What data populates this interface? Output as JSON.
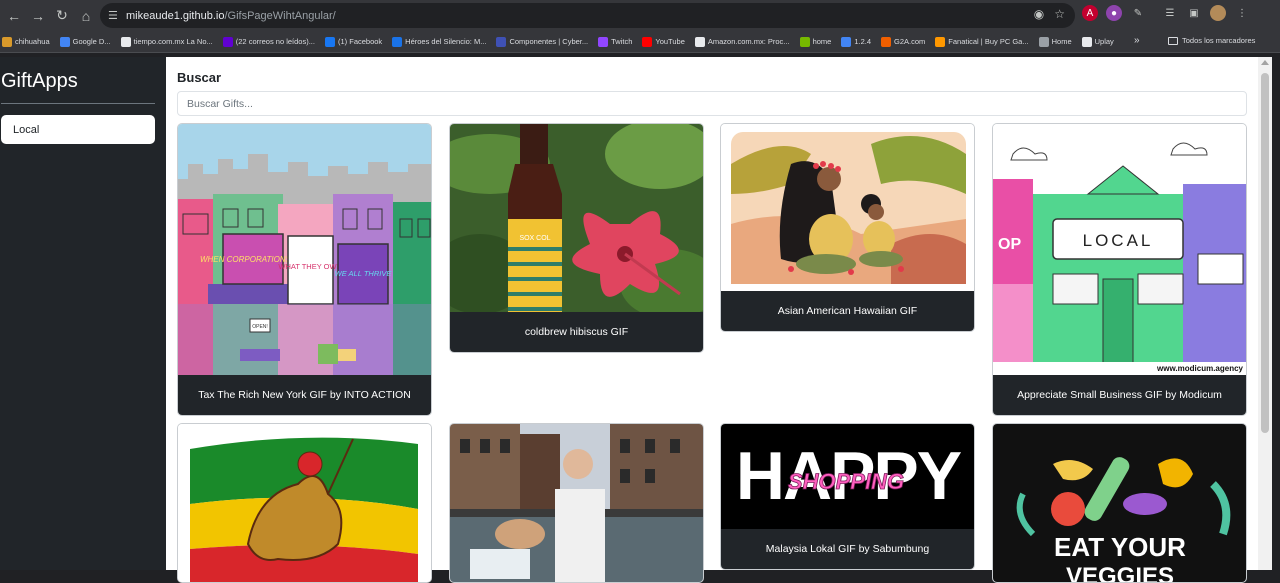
{
  "browser": {
    "url_host": "mikeaude1.github.io",
    "url_path": "/GifsPageWihtAngular/",
    "nav_icons": [
      "back-icon",
      "forward-icon",
      "reload-icon",
      "home-icon"
    ],
    "bookmarks": [
      {
        "label": "chihuahua",
        "color": "#d99a2b"
      },
      {
        "label": "Google D...",
        "color": "#4285f4"
      },
      {
        "label": "tiempo.com.mx La No...",
        "color": "#e8eaed"
      },
      {
        "label": "(22 correos no leídos)...",
        "color": "#6001d2"
      },
      {
        "label": "(1) Facebook",
        "color": "#1877f2"
      },
      {
        "label": "Héroes del Silencio: M...",
        "color": "#1a73e8"
      },
      {
        "label": "Componentes | Cyber...",
        "color": "#3f51b5"
      },
      {
        "label": "Twitch",
        "color": "#9146ff"
      },
      {
        "label": "YouTube",
        "color": "#ff0000"
      },
      {
        "label": "Amazon.com.mx: Proc...",
        "color": "#e8eaed"
      },
      {
        "label": "home",
        "color": "#76b900"
      },
      {
        "label": "1.2.4",
        "color": "#4285f4"
      },
      {
        "label": "G2A.com",
        "color": "#f05f00"
      },
      {
        "label": "Fanatical | Buy PC Ga...",
        "color": "#ff9800"
      },
      {
        "label": "Home",
        "color": "#9aa0a6"
      },
      {
        "label": "Uplay",
        "color": "#e8eaed"
      }
    ],
    "more_label": "»",
    "all_bookmarks_label": "Todos los marcadores"
  },
  "sidebar": {
    "brand": "GiftApps",
    "items": [
      {
        "label": "Local"
      }
    ]
  },
  "main": {
    "search_title": "Buscar",
    "search_placeholder": "Buscar Gifts...",
    "gifs": [
      {
        "caption": "Tax The Rich New York GIF by INTO ACTION"
      },
      {
        "caption": "coldbrew hibiscus GIF"
      },
      {
        "caption": "Asian American Hawaiian GIF"
      },
      {
        "caption": "Appreciate Small Business GIF by Modicum"
      },
      {
        "caption": ""
      },
      {
        "caption": ""
      },
      {
        "caption": "Malaysia Lokal GIF by Sabumbung"
      },
      {
        "caption": ""
      }
    ],
    "gif_texts": {
      "corporations": "WHEN CORPORATIONS pay",
      "what_they_owe": "WHAT THEY OWE",
      "we_all_thrive": "WE ALL THRIVE",
      "open": "OPEN!",
      "local": "LOCAL",
      "modicum": "www.modicum.agency",
      "happy": "HAPPY",
      "shopping": "SHOPPING",
      "eat_your": "EAT YOUR",
      "veggies": "VEGGIES",
      "bottle": "SOX COL"
    }
  }
}
